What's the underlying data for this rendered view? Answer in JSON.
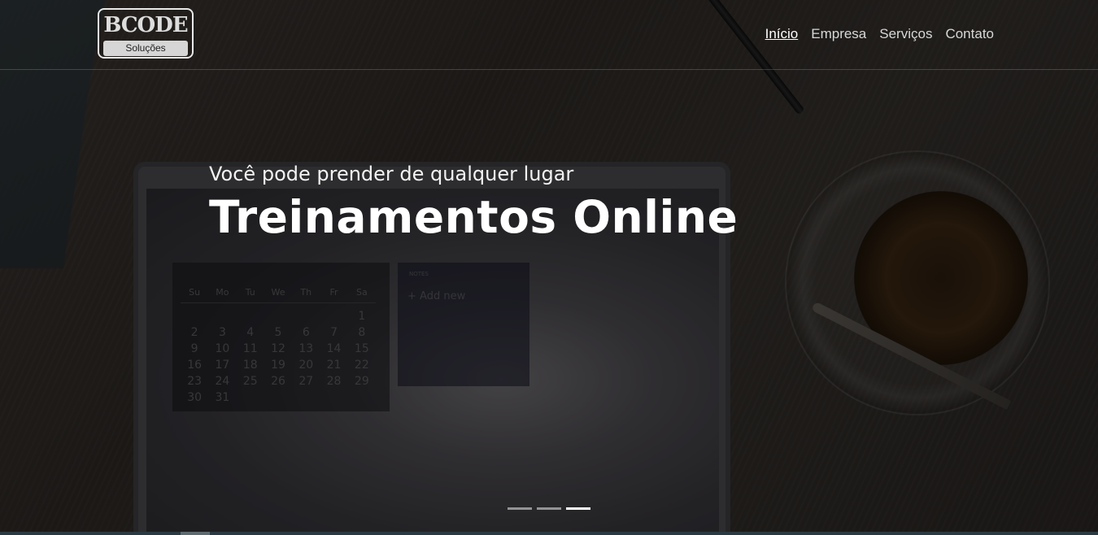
{
  "brand": {
    "logo_text": "BCODE",
    "logo_subtitle": "Soluções"
  },
  "nav": {
    "items": [
      {
        "label": "Início",
        "active": true
      },
      {
        "label": "Empresa",
        "active": false
      },
      {
        "label": "Serviços",
        "active": false
      },
      {
        "label": "Contato",
        "active": false
      }
    ]
  },
  "hero": {
    "subtitle": "Você pode prender de qualquer lugar",
    "title": "Treinamentos Online"
  },
  "carousel": {
    "slide_count": 3,
    "active_index": 2
  },
  "background_photo": {
    "calendar": {
      "weekdays": [
        "Su",
        "Mo",
        "Tu",
        "We",
        "Th",
        "Fr",
        "Sa"
      ],
      "rows": [
        [
          "",
          "",
          "",
          "",
          "",
          "",
          "1"
        ],
        [
          "2",
          "3",
          "4",
          "5",
          "6",
          "7",
          "8"
        ],
        [
          "9",
          "10",
          "11",
          "12",
          "13",
          "14",
          "15"
        ],
        [
          "16",
          "17",
          "18",
          "19",
          "20",
          "21",
          "22"
        ],
        [
          "23",
          "24",
          "25",
          "26",
          "27",
          "28",
          "29"
        ],
        [
          "30",
          "31",
          "",
          "",
          "",
          "",
          ""
        ]
      ]
    },
    "notes": {
      "title": "NOTES",
      "add_new": "+ Add new"
    }
  },
  "colors": {
    "nav_text": "#d8d8d8",
    "nav_active": "#ffffff",
    "hero_text": "#ffffff",
    "logo_border": "#e9e9e9"
  }
}
